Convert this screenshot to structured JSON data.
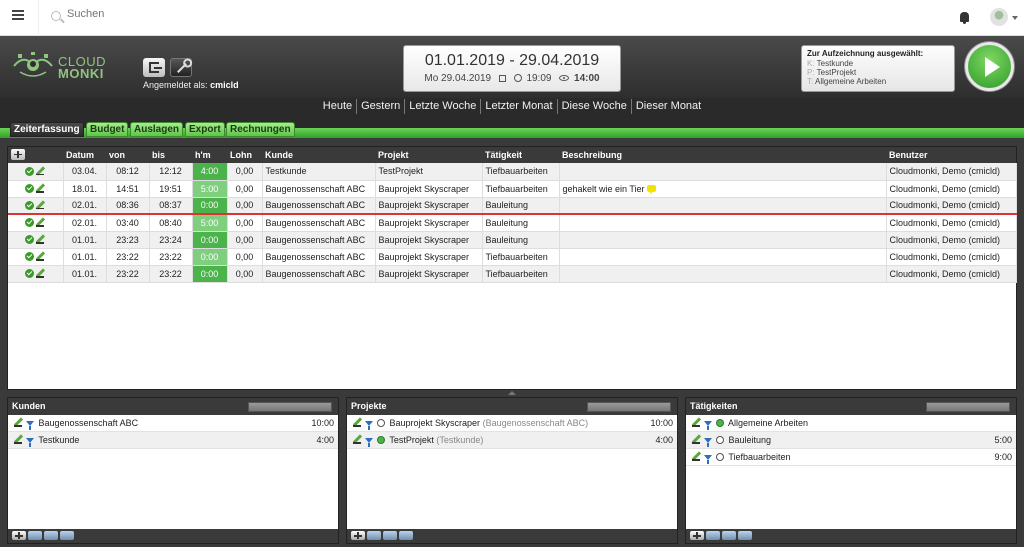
{
  "search": {
    "placeholder": "Suchen"
  },
  "header": {
    "logo_line1": "CLOUD",
    "logo_line2": "MONKI",
    "logged_in_label": "Angemeldet als:",
    "logged_in_user": "cmicld",
    "date_range": "01.01.2019 - 29.04.2019",
    "current_date": "Mo 29.04.2019",
    "current_time": "19:09",
    "total_hours": "14:00",
    "recording": {
      "title": "Zur Aufzeichnung ausgewählt:",
      "lines": [
        {
          "key": "K:",
          "value": "Testkunde"
        },
        {
          "key": "P:",
          "value": "TestProjekt"
        },
        {
          "key": "T:",
          "value": "Allgemeine Arbeiten"
        }
      ]
    }
  },
  "ranges": [
    "Heute",
    "Gestern",
    "Letzte Woche",
    "Letzter Monat",
    "Diese Woche",
    "Dieser Monat"
  ],
  "tabs": [
    "Zeiterfassung",
    "Budget",
    "Auslagen",
    "Export",
    "Rechnungen"
  ],
  "table": {
    "headers": [
      "Datum",
      "von",
      "bis",
      "h'm",
      "Lohn",
      "Kunde",
      "Projekt",
      "Tätigkeit",
      "Beschreibung",
      "Benutzer"
    ],
    "rows": [
      {
        "datum": "03.04.",
        "von": "08:12",
        "bis": "12:12",
        "hm": "4:00",
        "lohn": "0,00",
        "kunde": "Testkunde",
        "projekt": "TestProjekt",
        "taetigkeit": "Tiefbauarbeiten",
        "beschreibung": "",
        "benutzer": "Cloudmonki, Demo (cmicld)"
      },
      {
        "datum": "18.01.",
        "von": "14:51",
        "bis": "19:51",
        "hm": "5:00",
        "lohn": "0,00",
        "kunde": "Baugenossenschaft ABC",
        "projekt": "Bauprojekt Skyscraper",
        "taetigkeit": "Tiefbauarbeiten",
        "beschreibung": "gehakelt wie ein Tier",
        "benutzer": "Cloudmonki, Demo (cmicld)"
      },
      {
        "datum": "02.01.",
        "von": "08:36",
        "bis": "08:37",
        "hm": "0:00",
        "lohn": "0,00",
        "kunde": "Baugenossenschaft ABC",
        "projekt": "Bauprojekt Skyscraper",
        "taetigkeit": "Bauleitung",
        "beschreibung": "",
        "benutzer": "Cloudmonki, Demo (cmicld)"
      },
      {
        "datum": "02.01.",
        "von": "03:40",
        "bis": "08:40",
        "hm": "5:00",
        "lohn": "0,00",
        "kunde": "Baugenossenschaft ABC",
        "projekt": "Bauprojekt Skyscraper",
        "taetigkeit": "Bauleitung",
        "beschreibung": "",
        "benutzer": "Cloudmonki, Demo (cmicld)"
      },
      {
        "datum": "01.01.",
        "von": "23:23",
        "bis": "23:24",
        "hm": "0:00",
        "lohn": "0,00",
        "kunde": "Baugenossenschaft ABC",
        "projekt": "Bauprojekt Skyscraper",
        "taetigkeit": "Bauleitung",
        "beschreibung": "",
        "benutzer": "Cloudmonki, Demo (cmicld)"
      },
      {
        "datum": "01.01.",
        "von": "23:22",
        "bis": "23:22",
        "hm": "0:00",
        "lohn": "0,00",
        "kunde": "Baugenossenschaft ABC",
        "projekt": "Bauprojekt Skyscraper",
        "taetigkeit": "Tiefbauarbeiten",
        "beschreibung": "",
        "benutzer": "Cloudmonki, Demo (cmicld)"
      },
      {
        "datum": "01.01.",
        "von": "23:22",
        "bis": "23:22",
        "hm": "0:00",
        "lohn": "0,00",
        "kunde": "Baugenossenschaft ABC",
        "projekt": "Bauprojekt Skyscraper",
        "taetigkeit": "Tiefbauarbeiten",
        "beschreibung": "",
        "benutzer": "Cloudmonki, Demo (cmicld)"
      }
    ]
  },
  "panels": {
    "kunden": {
      "title": "Kunden",
      "items": [
        {
          "name": "Baugenossenschaft ABC",
          "value": "10:00"
        },
        {
          "name": "Testkunde",
          "value": "4:00"
        }
      ]
    },
    "projekte": {
      "title": "Projekte",
      "items": [
        {
          "name": "Bauprojekt Skyscraper",
          "sub": "(Baugenossenschaft ABC)",
          "value": "10:00",
          "selected": false
        },
        {
          "name": "TestProjekt",
          "sub": "(Testkunde)",
          "value": "4:00",
          "selected": true
        }
      ]
    },
    "taetigkeiten": {
      "title": "Tätigkeiten",
      "items": [
        {
          "name": "Allgemeine Arbeiten",
          "value": "",
          "selected": true
        },
        {
          "name": "Bauleitung",
          "value": "5:00",
          "selected": false
        },
        {
          "name": "Tiefbauarbeiten",
          "value": "9:00",
          "selected": false
        }
      ]
    }
  },
  "colors": {
    "accent_green": "#4cb24c",
    "header_dark": "#3a3a3a",
    "separator_red": "#dd3333"
  }
}
